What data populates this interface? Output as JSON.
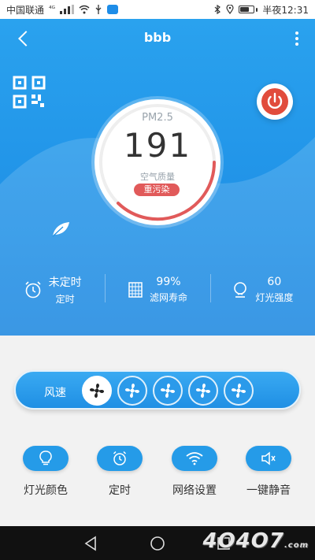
{
  "status_bar": {
    "carrier": "中国联通",
    "network": "⁴ᴳ",
    "time": "半夜12:31"
  },
  "app": {
    "title": "bbb"
  },
  "gauge": {
    "label": "PM2.5",
    "value": "191",
    "quality_label": "空气质量",
    "level": "重污染",
    "colors": {
      "accent": "#e15a5a",
      "track": "#eeeeee"
    }
  },
  "stats": [
    {
      "value": "未定时",
      "label": "定时",
      "icon": "alarm-clock-icon"
    },
    {
      "value": "99%",
      "label": "滤网寿命",
      "icon": "filter-icon"
    },
    {
      "value": "60",
      "label": "灯光强度",
      "icon": "lamp-icon"
    }
  ],
  "fan_speed": {
    "label": "风速",
    "levels": 5,
    "selected": 1
  },
  "actions": [
    {
      "label": "灯光颜色",
      "icon": "bulb-icon"
    },
    {
      "label": "定时",
      "icon": "alarm-clock-icon"
    },
    {
      "label": "网络设置",
      "icon": "wifi-icon"
    },
    {
      "label": "一键静音",
      "icon": "mute-icon"
    }
  ],
  "watermark": {
    "text": "4O4O7",
    "suffix": ".com"
  },
  "colors": {
    "header_blue": "#1e8fe6",
    "button_blue": "#259be8",
    "power_red": "#e14c3c"
  }
}
